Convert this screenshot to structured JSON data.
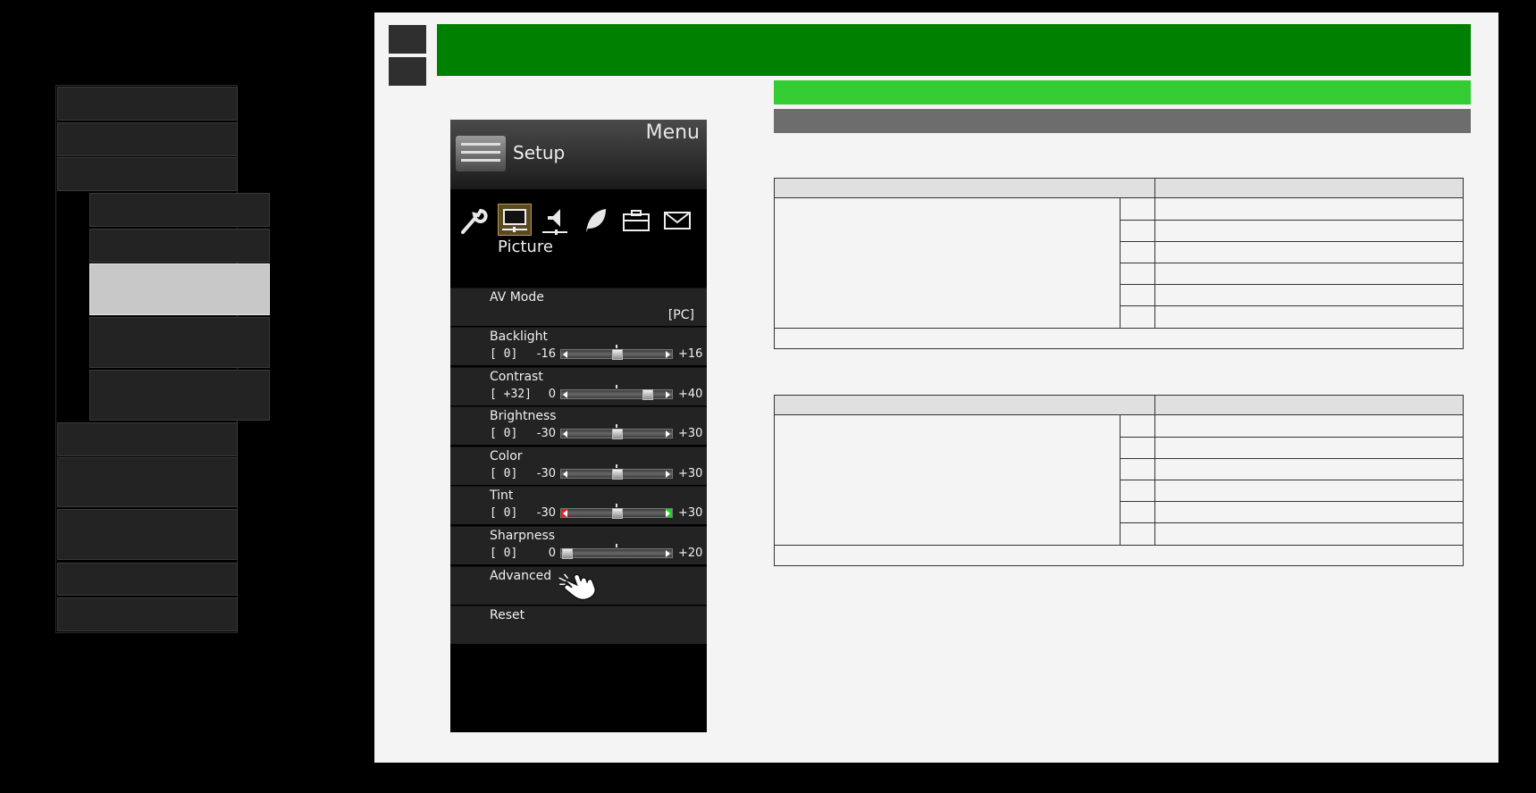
{
  "left_nav": {
    "items": [
      {
        "label": ""
      },
      {
        "label": ""
      },
      {
        "label": ""
      },
      {
        "label": ""
      },
      {
        "label": ""
      },
      {
        "label": ""
      },
      {
        "label": ""
      },
      {
        "label": ""
      },
      {
        "label": ""
      },
      {
        "label": ""
      },
      {
        "label": ""
      },
      {
        "label": ""
      },
      {
        "label": ""
      }
    ],
    "active_index": 5
  },
  "colors": {
    "banner": "#008000",
    "subbanner": "#33cc33",
    "greybar": "#6d6d6d",
    "nav_active": "#c8c8c8"
  },
  "tv_menu": {
    "title": "Menu",
    "section": "Setup",
    "category": "Picture",
    "category_icons": [
      "wrench-icon",
      "picture-icon",
      "speaker-icon",
      "leaf-icon",
      "briefcase-icon",
      "envelope-icon"
    ],
    "items": [
      {
        "label": "AV Mode",
        "value": "[PC]"
      },
      {
        "label": "Backlight",
        "bracket": "[    0]",
        "min": "-16",
        "max": "+16",
        "level": 0.5
      },
      {
        "label": "Contrast",
        "bracket": "[ +32]",
        "min": "0",
        "max": "+40",
        "level": 0.8
      },
      {
        "label": "Brightness",
        "bracket": "[    0]",
        "min": "-30",
        "max": "+30",
        "level": 0.5
      },
      {
        "label": "Color",
        "bracket": "[    0]",
        "min": "-30",
        "max": "+30",
        "level": 0.5
      },
      {
        "label": "Tint",
        "bracket": "[    0]",
        "min": "-30",
        "max": "+30",
        "level": 0.5
      },
      {
        "label": "Sharpness",
        "bracket": "[    0]",
        "min": "0",
        "max": "+20",
        "level": 0.0
      },
      {
        "label": "Advanced"
      },
      {
        "label": "Reset"
      }
    ]
  },
  "tables": [
    {
      "rows": 6
    },
    {
      "rows": 6
    }
  ]
}
